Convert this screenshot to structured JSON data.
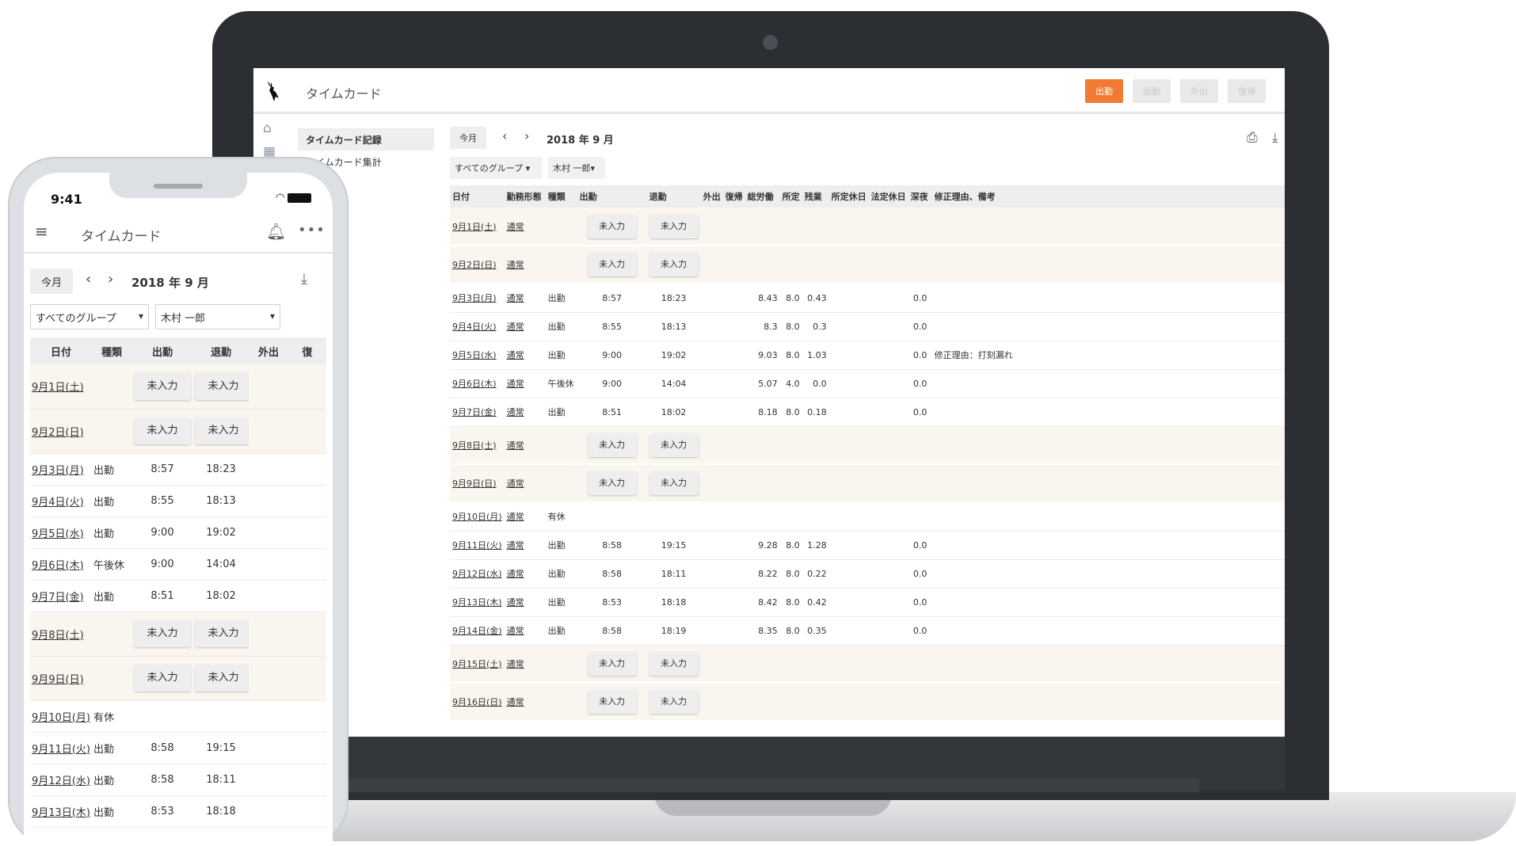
{
  "laptop": {
    "app_title": "タイムカード",
    "header_buttons": [
      {
        "label": "出勤",
        "state": "primary"
      },
      {
        "label": "退勤",
        "state": "disabled"
      },
      {
        "label": "外出",
        "state": "disabled"
      },
      {
        "label": "復帰",
        "state": "disabled"
      }
    ],
    "sidebar_icons": [
      "home-icon",
      "calendar-icon"
    ],
    "subnav": [
      {
        "label": "タイムカード記録",
        "active": true
      },
      {
        "label": "タイムカード集計",
        "active": false
      }
    ],
    "controls": {
      "today": "今月",
      "month": "2018 年 9 月",
      "group_select": "すべてのグループ",
      "user_select": "木村 一郎"
    },
    "columns": [
      "日付",
      "勤務形態",
      "種類",
      "出勤",
      "退勤",
      "外出",
      "復帰",
      "総労働",
      "所定",
      "残業",
      "所定休日",
      "法定休日",
      "深夜",
      "修正理由、備考"
    ],
    "rows": [
      {
        "date": "9月1日(土)",
        "form": "通常",
        "type": "",
        "in": "未入力",
        "out": "未入力",
        "missing": true,
        "total": "",
        "scheduled": "",
        "overtime": "",
        "night": "",
        "note": ""
      },
      {
        "date": "9月2日(日)",
        "form": "通常",
        "type": "",
        "in": "未入力",
        "out": "未入力",
        "missing": true,
        "total": "",
        "scheduled": "",
        "overtime": "",
        "night": "",
        "note": ""
      },
      {
        "date": "9月3日(月)",
        "form": "通常",
        "type": "出勤",
        "in": "8:57",
        "out": "18:23",
        "missing": false,
        "total": "8.43",
        "scheduled": "8.0",
        "overtime": "0.43",
        "night": "0.0",
        "note": ""
      },
      {
        "date": "9月4日(火)",
        "form": "通常",
        "type": "出勤",
        "in": "8:55",
        "out": "18:13",
        "missing": false,
        "total": "8.3",
        "scheduled": "8.0",
        "overtime": "0.3",
        "night": "0.0",
        "note": ""
      },
      {
        "date": "9月5日(水)",
        "form": "通常",
        "type": "出勤",
        "in": "9:00",
        "out": "19:02",
        "missing": false,
        "total": "9.03",
        "scheduled": "8.0",
        "overtime": "1.03",
        "night": "0.0",
        "note": "修正理由：打刻漏れ"
      },
      {
        "date": "9月6日(木)",
        "form": "通常",
        "type": "午後休",
        "in": "9:00",
        "out": "14:04",
        "missing": false,
        "total": "5.07",
        "scheduled": "4.0",
        "overtime": "0.0",
        "night": "0.0",
        "note": ""
      },
      {
        "date": "9月7日(金)",
        "form": "通常",
        "type": "出勤",
        "in": "8:51",
        "out": "18:02",
        "missing": false,
        "total": "8.18",
        "scheduled": "8.0",
        "overtime": "0.18",
        "night": "0.0",
        "note": ""
      },
      {
        "date": "9月8日(土)",
        "form": "通常",
        "type": "",
        "in": "未入力",
        "out": "未入力",
        "missing": true,
        "total": "",
        "scheduled": "",
        "overtime": "",
        "night": "",
        "note": ""
      },
      {
        "date": "9月9日(日)",
        "form": "通常",
        "type": "",
        "in": "未入力",
        "out": "未入力",
        "missing": true,
        "total": "",
        "scheduled": "",
        "overtime": "",
        "night": "",
        "note": ""
      },
      {
        "date": "9月10日(月)",
        "form": "通常",
        "type": "有休",
        "in": "",
        "out": "",
        "missing": false,
        "total": "",
        "scheduled": "",
        "overtime": "",
        "night": "",
        "note": ""
      },
      {
        "date": "9月11日(火)",
        "form": "通常",
        "type": "出勤",
        "in": "8:58",
        "out": "19:15",
        "missing": false,
        "total": "9.28",
        "scheduled": "8.0",
        "overtime": "1.28",
        "night": "0.0",
        "note": ""
      },
      {
        "date": "9月12日(水)",
        "form": "通常",
        "type": "出勤",
        "in": "8:58",
        "out": "18:11",
        "missing": false,
        "total": "8.22",
        "scheduled": "8.0",
        "overtime": "0.22",
        "night": "0.0",
        "note": ""
      },
      {
        "date": "9月13日(木)",
        "form": "通常",
        "type": "出勤",
        "in": "8:53",
        "out": "18:18",
        "missing": false,
        "total": "8.42",
        "scheduled": "8.0",
        "overtime": "0.42",
        "night": "0.0",
        "note": ""
      },
      {
        "date": "9月14日(金)",
        "form": "通常",
        "type": "出勤",
        "in": "8:58",
        "out": "18:19",
        "missing": false,
        "total": "8.35",
        "scheduled": "8.0",
        "overtime": "0.35",
        "night": "0.0",
        "note": ""
      },
      {
        "date": "9月15日(土)",
        "form": "通常",
        "type": "",
        "in": "未入力",
        "out": "未入力",
        "missing": true,
        "total": "",
        "scheduled": "",
        "overtime": "",
        "night": "",
        "note": ""
      },
      {
        "date": "9月16日(日)",
        "form": "通常",
        "type": "",
        "in": "未入力",
        "out": "未入力",
        "missing": true,
        "total": "",
        "scheduled": "",
        "overtime": "",
        "night": "",
        "note": ""
      }
    ]
  },
  "phone": {
    "status_time": "9:41",
    "app_title": "タイムカード",
    "controls": {
      "today": "今月",
      "month": "2018 年 9 月",
      "group_select": "すべてのグループ",
      "user_select": "木村 一郎"
    },
    "columns": [
      "日付",
      "種類",
      "出勤",
      "退勤",
      "外出",
      "復"
    ],
    "rows": [
      {
        "date": "9月1日(土)",
        "type": "",
        "in": "未入力",
        "out": "未入力",
        "missing": true
      },
      {
        "date": "9月2日(日)",
        "type": "",
        "in": "未入力",
        "out": "未入力",
        "missing": true
      },
      {
        "date": "9月3日(月)",
        "type": "出勤",
        "in": "8:57",
        "out": "18:23",
        "missing": false
      },
      {
        "date": "9月4日(火)",
        "type": "出勤",
        "in": "8:55",
        "out": "18:13",
        "missing": false
      },
      {
        "date": "9月5日(水)",
        "type": "出勤",
        "in": "9:00",
        "out": "19:02",
        "missing": false
      },
      {
        "date": "9月6日(木)",
        "type": "午後休",
        "in": "9:00",
        "out": "14:04",
        "missing": false
      },
      {
        "date": "9月7日(金)",
        "type": "出勤",
        "in": "8:51",
        "out": "18:02",
        "missing": false
      },
      {
        "date": "9月8日(土)",
        "type": "",
        "in": "未入力",
        "out": "未入力",
        "missing": true
      },
      {
        "date": "9月9日(日)",
        "type": "",
        "in": "未入力",
        "out": "未入力",
        "missing": true
      },
      {
        "date": "9月10日(月)",
        "type": "有休",
        "in": "",
        "out": "",
        "missing": false
      },
      {
        "date": "9月11日(火)",
        "type": "出勤",
        "in": "8:58",
        "out": "19:15",
        "missing": false
      },
      {
        "date": "9月12日(水)",
        "type": "出勤",
        "in": "8:58",
        "out": "18:11",
        "missing": false
      },
      {
        "date": "9月13日(木)",
        "type": "出勤",
        "in": "8:53",
        "out": "18:18",
        "missing": false
      }
    ]
  },
  "colors": {
    "accent": "#f17b34",
    "weekend_row": "#fbf5ef",
    "laptop_frame": "#2b2e33"
  }
}
